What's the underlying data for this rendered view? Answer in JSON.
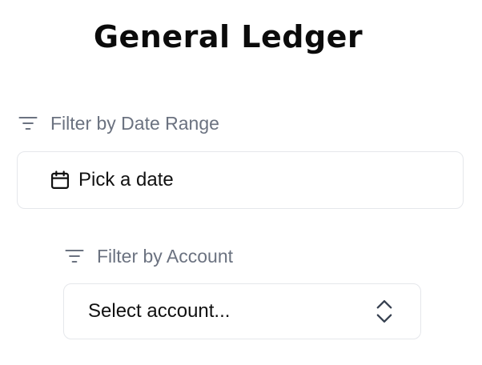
{
  "page": {
    "title": "General Ledger"
  },
  "filters": {
    "date": {
      "label": "Filter by Date Range",
      "icon": "filter-icon",
      "picker_icon": "calendar-icon",
      "placeholder": "Pick a date"
    },
    "account": {
      "label": "Filter by Account",
      "icon": "filter-icon",
      "chevron_icon": "chevron-up-down-icon",
      "placeholder": "Select account..."
    }
  },
  "colors": {
    "title": "#0b0b0b",
    "label": "#6b7280",
    "border": "#e5e7eb",
    "text": "#111111"
  }
}
